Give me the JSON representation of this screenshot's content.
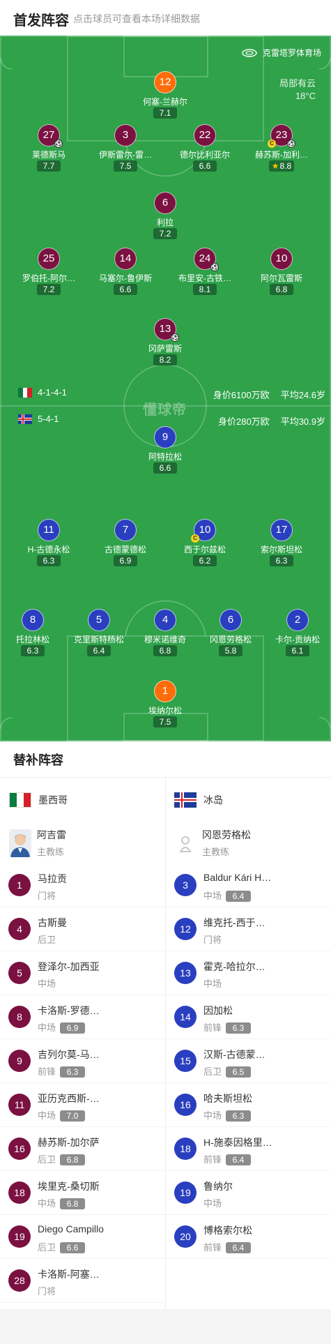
{
  "header": {
    "title": "首发阵容",
    "subtitle": "点击球员可查看本场详细数据"
  },
  "pitch": {
    "venue": "克雷塔罗体育场",
    "weather": "局部有云",
    "temperature": "18°C",
    "watermark": "懂球帝",
    "home": {
      "formation": "4-1-4-1",
      "value": "身价6100万欧",
      "avg_age": "平均24.6岁"
    },
    "away": {
      "formation": "5-4-1",
      "value": "身价280万欧",
      "avg_age": "平均30.9岁"
    }
  },
  "home_players": [
    {
      "num": "12",
      "name": "何塞-兰赫尔",
      "rating": "7.1",
      "gk": true
    },
    {
      "num": "27",
      "name": "莱德斯马",
      "rating": "7.7",
      "goal": true
    },
    {
      "num": "3",
      "name": "伊斯雷尔-雷…",
      "rating": "7.5"
    },
    {
      "num": "22",
      "name": "德尔比利亚尔",
      "rating": "6.6"
    },
    {
      "num": "23",
      "name": "赫苏斯-加利…",
      "rating": "8.8",
      "goal": true,
      "captain": true,
      "star": true
    },
    {
      "num": "6",
      "name": "利拉",
      "rating": "7.2"
    },
    {
      "num": "25",
      "name": "罗伯托-阿尔…",
      "rating": "7.2"
    },
    {
      "num": "14",
      "name": "马塞尔-鲁伊斯",
      "rating": "6.6"
    },
    {
      "num": "24",
      "name": "布里安-古铁…",
      "rating": "8.1",
      "goal": true
    },
    {
      "num": "10",
      "name": "阿尔瓦雷斯",
      "rating": "6.8"
    },
    {
      "num": "13",
      "name": "冈萨雷斯",
      "rating": "8.2",
      "goal": true
    }
  ],
  "away_players": [
    {
      "num": "9",
      "name": "阿特拉松",
      "rating": "6.6"
    },
    {
      "num": "11",
      "name": "H-古德永松",
      "rating": "6.3"
    },
    {
      "num": "7",
      "name": "古德蒙德松",
      "rating": "6.9"
    },
    {
      "num": "10",
      "name": "西于尔兹松",
      "rating": "6.2",
      "captain": true
    },
    {
      "num": "17",
      "name": "索尔斯坦松",
      "rating": "6.3"
    },
    {
      "num": "8",
      "name": "托拉林松",
      "rating": "6.3"
    },
    {
      "num": "5",
      "name": "克里斯特杨松",
      "rating": "6.4"
    },
    {
      "num": "4",
      "name": "穆米诺维奇",
      "rating": "6.8"
    },
    {
      "num": "6",
      "name": "冈恩劳格松",
      "rating": "5.8"
    },
    {
      "num": "2",
      "name": "卡尔-贡纳松",
      "rating": "6.1"
    },
    {
      "num": "1",
      "name": "埃纳尔松",
      "rating": "7.5",
      "gk": true
    }
  ],
  "bench": {
    "title": "替补阵容",
    "home_team": "墨西哥",
    "away_team": "冰岛",
    "home_coach": {
      "name": "阿吉雷",
      "role": "主教练"
    },
    "away_coach": {
      "name": "冈恩劳格松",
      "role": "主教练"
    },
    "home_subs": [
      {
        "num": "1",
        "name": "马拉贡",
        "pos": "门将",
        "rating": ""
      },
      {
        "num": "4",
        "name": "古斯曼",
        "pos": "后卫",
        "rating": ""
      },
      {
        "num": "5",
        "name": "登泽尔-加西亚",
        "pos": "中场",
        "rating": ""
      },
      {
        "num": "8",
        "name": "卡洛斯-罗德…",
        "pos": "中场",
        "rating": "6.9"
      },
      {
        "num": "9",
        "name": "吉列尔莫-马…",
        "pos": "前锋",
        "rating": "6.3"
      },
      {
        "num": "11",
        "name": "亚历克西斯-…",
        "pos": "中场",
        "rating": "7.0"
      },
      {
        "num": "16",
        "name": "赫苏斯-加尔萨",
        "pos": "后卫",
        "rating": "6.8"
      },
      {
        "num": "18",
        "name": "埃里克-桑切斯",
        "pos": "中场",
        "rating": "6.8"
      },
      {
        "num": "19",
        "name": "Diego Campillo",
        "pos": "后卫",
        "rating": "6.6"
      },
      {
        "num": "28",
        "name": "卡洛斯-阿塞…",
        "pos": "门将",
        "rating": ""
      }
    ],
    "away_subs": [
      {
        "num": "3",
        "name": "Baldur Kári H…",
        "pos": "中场",
        "rating": "6.4"
      },
      {
        "num": "12",
        "name": "维克托-西于…",
        "pos": "门将",
        "rating": ""
      },
      {
        "num": "13",
        "name": "霍克-哈拉尔…",
        "pos": "中场",
        "rating": ""
      },
      {
        "num": "14",
        "name": "因加松",
        "pos": "前锋",
        "rating": "6.3"
      },
      {
        "num": "15",
        "name": "汉斯-古德蒙…",
        "pos": "后卫",
        "rating": "6.5"
      },
      {
        "num": "16",
        "name": "哈夫斯坦松",
        "pos": "中场",
        "rating": "6.3"
      },
      {
        "num": "18",
        "name": "H-施泰因格里…",
        "pos": "前锋",
        "rating": "6.4"
      },
      {
        "num": "19",
        "name": "鲁纳尔",
        "pos": "中场",
        "rating": ""
      },
      {
        "num": "20",
        "name": "博格索尔松",
        "pos": "前锋",
        "rating": "6.4"
      }
    ]
  },
  "colors": {
    "pitch": "#2fa24a",
    "home": "#7a1140",
    "away": "#2a3fbf",
    "goalkeeper": "#ff6d0a"
  }
}
